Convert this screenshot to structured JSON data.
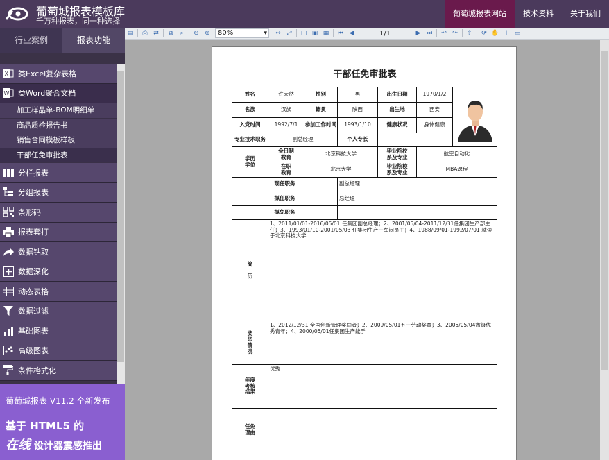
{
  "header": {
    "logo_title": "葡萄城报表模板库",
    "logo_subtitle": "千万种报表，同一种选择",
    "nav": [
      {
        "label": "葡萄城报表网站"
      },
      {
        "label": "技术资料"
      },
      {
        "label": "关于我们"
      }
    ]
  },
  "sidebar": {
    "tabs": [
      {
        "label": "行业案例"
      },
      {
        "label": "报表功能"
      }
    ],
    "items": [
      {
        "label": "类Excel复杂表格",
        "icon": "excel-icon"
      },
      {
        "label": "类Word聚合文档",
        "icon": "word-icon"
      },
      {
        "label": "分栏报表",
        "icon": "columns-icon"
      },
      {
        "label": "分组报表",
        "icon": "group-icon"
      },
      {
        "label": "条形码",
        "icon": "qrcode-icon"
      },
      {
        "label": "报表套打",
        "icon": "printer-icon"
      },
      {
        "label": "数据钻取",
        "icon": "drill-icon"
      },
      {
        "label": "数据深化",
        "icon": "expand-icon"
      },
      {
        "label": "动态表格",
        "icon": "table-icon"
      },
      {
        "label": "数据过滤",
        "icon": "filter-icon"
      },
      {
        "label": "基础图表",
        "icon": "bar-chart-icon"
      },
      {
        "label": "高级图表",
        "icon": "scatter-chart-icon"
      },
      {
        "label": "条件格式化",
        "icon": "paint-roller-icon"
      }
    ],
    "subitems": [
      {
        "label": "加工样品单-BOM明细单"
      },
      {
        "label": "商品质检报告书"
      },
      {
        "label": "销售合同模板样板"
      },
      {
        "label": "干部任免审批表"
      }
    ]
  },
  "promo": {
    "line1": "葡萄城报表 V11.2 全新发布",
    "line2": "基于 HTML5 的",
    "line3_em": "在线",
    "line3_rest": " 设计器震感推出"
  },
  "toolbar": {
    "zoom": "80%",
    "page": "1/1"
  },
  "document": {
    "title": "干部任免审批表",
    "labels": {
      "name": "姓名",
      "gender": "性别",
      "birth": "出生日期",
      "ethnic": "名族",
      "native": "籍贯",
      "birthplace": "出生地",
      "party": "入党时间",
      "work": "参加工作时间",
      "health": "健康状况",
      "title": "专业技术职务",
      "specialty": "个人专长",
      "edu": "学历\n学位",
      "fulltime": "全日制\n教育",
      "school1": "毕业院校\n系及专业",
      "inservice": "在职\n教育",
      "school2": "毕业院校\n系及专业",
      "current": "现任职务",
      "proposed": "拟任职务",
      "dismiss": "拟免职务",
      "resume": "简\n\n历",
      "awards": "奖\n惩\n情\n况",
      "review": "年度\n考核\n结果",
      "reason": "任免\n理由"
    },
    "values": {
      "name": "许天然",
      "gender": "男",
      "birth": "1970/1/2",
      "ethnic": "汉族",
      "native": "陕西",
      "birthplace": "西安",
      "party": "1992/7/1",
      "work": "1993/1/10",
      "health": "身体健康",
      "title": "副总经理",
      "specialty": "",
      "fulltime_school": "北京科技大学",
      "fulltime_major": "航空自动化",
      "inservice_school": "北京大学",
      "inservice_major": "MBA课程",
      "current": "副总经理",
      "proposed": "总经理",
      "dismiss": "",
      "resume": "1、2011/01/01-2016/05/01 任集团副总经理；2、2001/05/04-2011/12/31任集团生产部主任；3、1993/01/10-2001/05/03 任集团生产一车间员工；4、1988/09/01-1992/07/01 就读于北京科技大学",
      "awards": "1、2012/12/31 全国创新管理奖励者；2、2009/05/01五一劳动奖章；3、2005/05/04市级优秀青年；4、2000/05/01任集团生产能手",
      "review": "优秀",
      "reason": ""
    }
  },
  "colors": {
    "header_bg": "#4b3a5c",
    "nav_active": "#6a1a4c",
    "sidebar_bg": "#3b3247",
    "promo_bg": "#8a5fd0",
    "viewer_bg": "#a9a9a9"
  }
}
